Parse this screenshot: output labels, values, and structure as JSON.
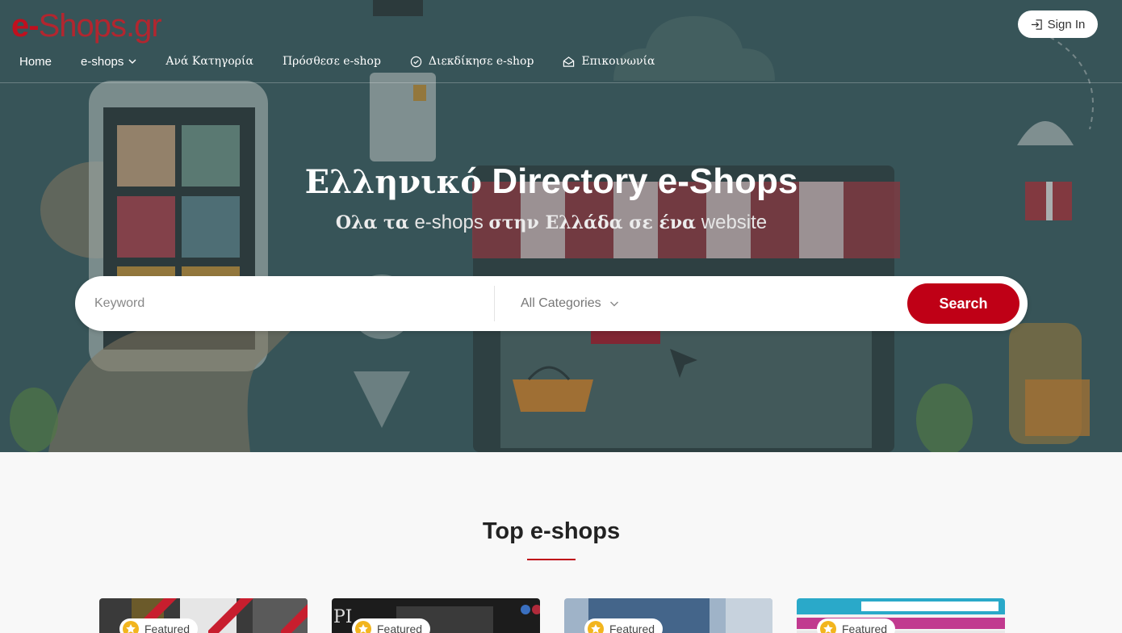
{
  "logo": {
    "e": "e-",
    "rest": "Shops.gr"
  },
  "nav": {
    "items": [
      {
        "label": "Home"
      },
      {
        "label": "e-shops"
      },
      {
        "label": "Ανά Κατηγορία"
      },
      {
        "label": "Πρόσθεσε e-shop"
      },
      {
        "label": "Διεκδίκησε e-shop"
      },
      {
        "label": "Επικοινωνία"
      }
    ]
  },
  "signin": {
    "label": "Sign In"
  },
  "hero": {
    "title_gr": "Ελληνικό",
    "title_en": "Directory e-Shops",
    "sub_1": "Ολα τα",
    "sub_2": "e-shops",
    "sub_3": "στην Ελλάδα σε ένα",
    "sub_4": "website"
  },
  "search": {
    "keyword_placeholder": "Keyword",
    "category_selected": "All Categories",
    "button_label": "Search"
  },
  "top_eshops": {
    "title": "Top e-shops",
    "cards": [
      {
        "badge": "Featured"
      },
      {
        "badge": "Featured"
      },
      {
        "badge": "Featured"
      },
      {
        "badge": "Featured"
      }
    ]
  },
  "colors": {
    "accent": "#bf0016",
    "hero_bg": "#3a5a5e"
  }
}
